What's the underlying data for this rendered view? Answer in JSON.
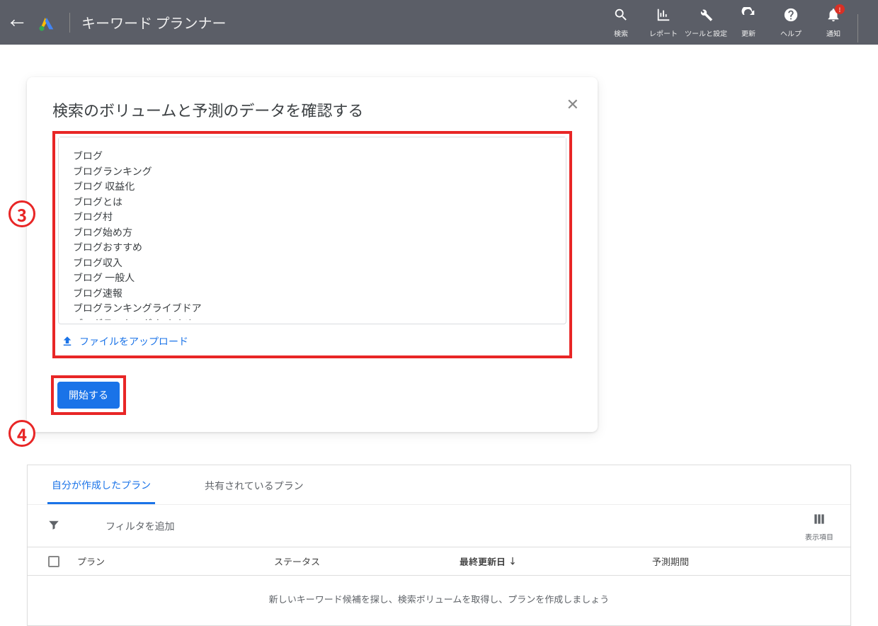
{
  "header": {
    "title": "キーワード プランナー",
    "tools": {
      "search": "検索",
      "reports": "レポート",
      "tools_settings": "ツールと設定",
      "refresh": "更新",
      "help": "ヘルプ",
      "notifications": "通知",
      "notif_badge": "!"
    }
  },
  "card": {
    "title": "検索のボリュームと予測のデータを確認する",
    "textarea_value": "ブログ\nブログランキング\nブログ 収益化\nブログとは\nブログ村\nブログ始め方\nブログおすすめ\nブログ収入\nブログ 一般人\nブログ速報\nブログランキングライブドア\nブログランキング おすすめ",
    "upload_label": "ファイルをアップロード",
    "start_button": "開始する"
  },
  "annotations": {
    "badge3": "3",
    "badge4": "4"
  },
  "plans": {
    "tab_mine": "自分が作成したプラン",
    "tab_shared": "共有されているプラン",
    "filter_placeholder": "フィルタを追加",
    "columns_label": "表示項目",
    "col_plan": "プラン",
    "col_status": "ステータス",
    "col_updated": "最終更新日",
    "col_period": "予測期間",
    "empty_message": "新しいキーワード候補を探し、検索ボリュームを取得し、プランを作成しましょう"
  }
}
